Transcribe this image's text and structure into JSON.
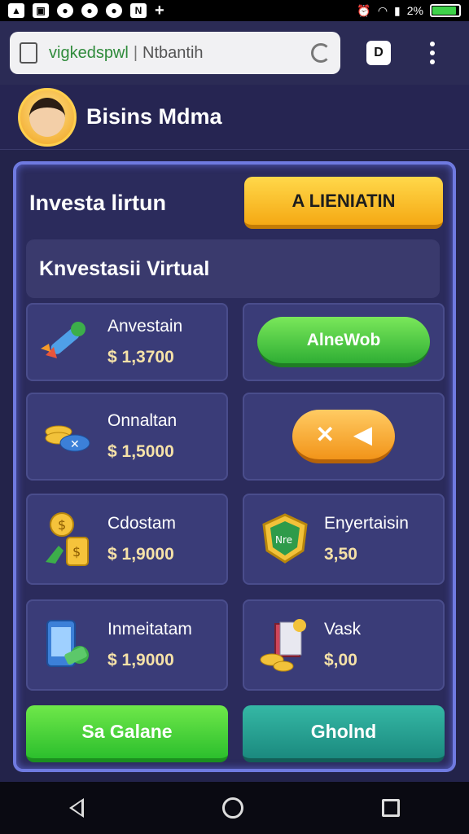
{
  "status_bar": {
    "left_icons": [
      "photo-icon",
      "message-icon",
      "app-icon",
      "app-icon",
      "app-icon",
      "app-icon",
      "plus-icon"
    ],
    "right_text": "2%"
  },
  "browser": {
    "url": "vigkedspwl",
    "url_extra": "Ntbantih",
    "tab_count": "D"
  },
  "app": {
    "title": "Bisins Mdma"
  },
  "panel": {
    "heading": "Investa lirtun",
    "top_button": "A LIENIATIN",
    "subtitle": "Knvestasii Virtual"
  },
  "cards": [
    {
      "name": "Anvestain",
      "price": "$ 1,3700"
    },
    {
      "name": "Onnaltan",
      "price": "$ 1,5000"
    },
    {
      "name": "Cdostam",
      "price": "$ 1,9000"
    },
    {
      "name": "Enyertaisin",
      "price": "3,50"
    },
    {
      "name": "Inmeitatam",
      "price": "$ 1,9000"
    },
    {
      "name": "Vask",
      "price": "$,00"
    }
  ],
  "side_buttons": {
    "green": "AlneWob",
    "orange_left": "✕",
    "orange_right": "◀"
  },
  "badge_text": "Nre",
  "bottom_buttons": {
    "left": "Sa Galane",
    "right": "Gholnd"
  },
  "colors": {
    "gold": "#f5a914",
    "green": "#2fae34",
    "teal": "#1b8a7f",
    "panel_border": "#6f7ae0"
  }
}
